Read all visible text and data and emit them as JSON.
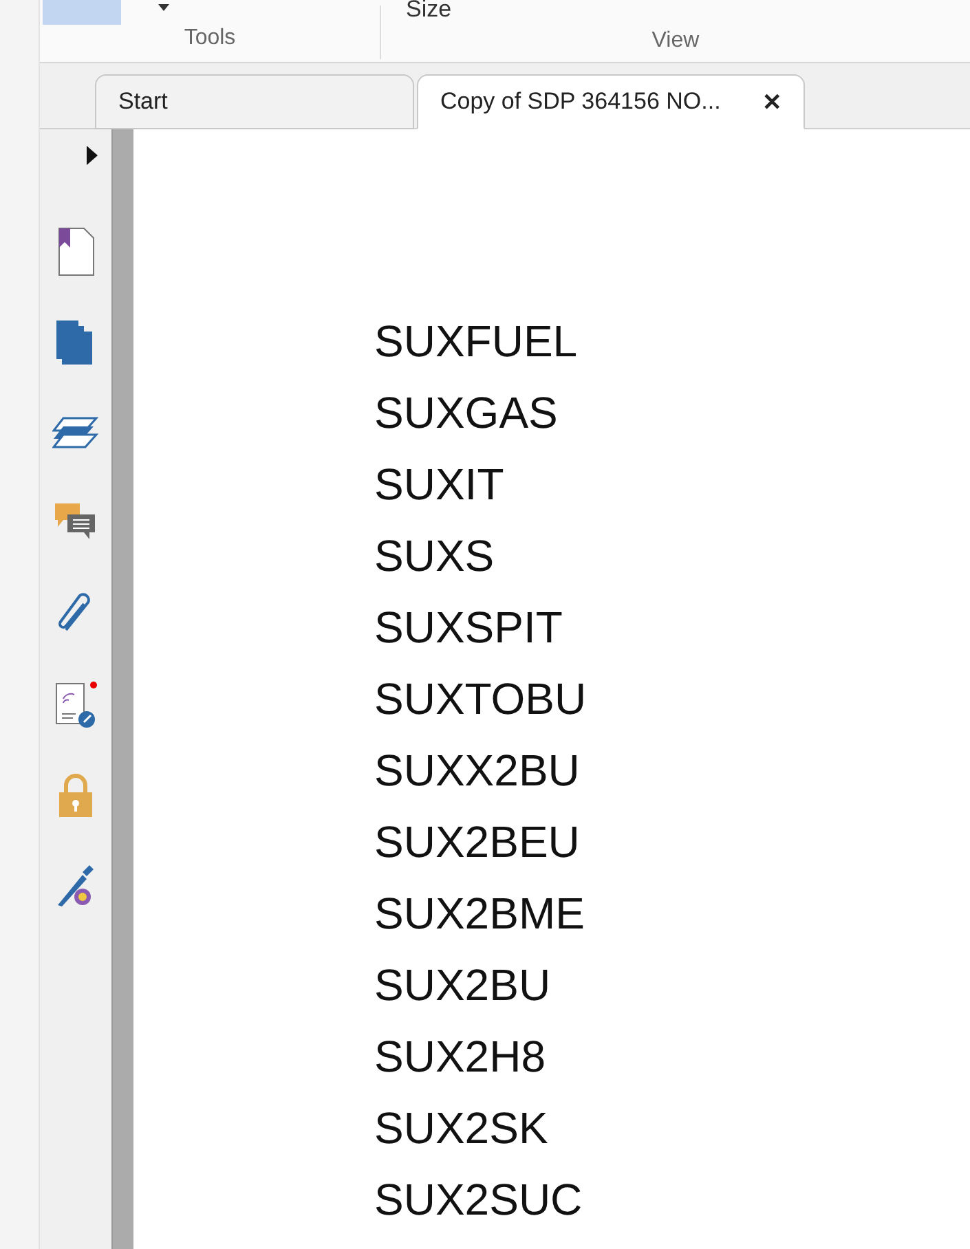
{
  "ribbon": {
    "size_label": "Size",
    "groups": [
      {
        "label": "Tools"
      },
      {
        "label": "View"
      }
    ]
  },
  "tabs": [
    {
      "label": "Start",
      "selected": false,
      "closable": false
    },
    {
      "label": "Copy of SDP 364156 NO...",
      "selected": true,
      "closable": true
    }
  ],
  "close_glyph": "✕",
  "document": {
    "lines": [
      "SUXFUEL",
      "SUXGAS",
      "SUXIT",
      "SUXS",
      "SUXSPIT",
      "SUXTOBU",
      "SUXX2BU",
      "SUX2BEU",
      "SUX2BME",
      "SUX2BU",
      "SUX2H8",
      "SUX2SK",
      "SUX2SUC"
    ]
  }
}
